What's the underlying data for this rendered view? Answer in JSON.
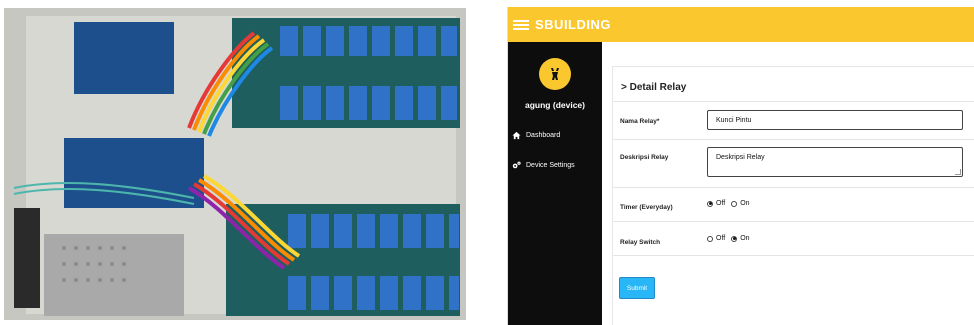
{
  "app": {
    "brand": "SBUILDING",
    "device_name": "agung (device)",
    "nav": [
      {
        "label": "Dashboard",
        "icon": "home-icon"
      },
      {
        "label": "Device Settings",
        "icon": "gears-icon"
      }
    ]
  },
  "detail": {
    "title": "> Detail Relay",
    "fields": {
      "nama_label": "Nama Relay*",
      "nama_value": "Kunci Pintu",
      "deskripsi_label": "Deskripsi Relay",
      "deskripsi_value": "Deskripsi Relay",
      "timer_label": "Timer (Everyday)",
      "timer_options": [
        "Off",
        "On"
      ],
      "timer_selected": "Off",
      "switch_label": "Relay Switch",
      "switch_options": [
        "Off",
        "On"
      ],
      "switch_selected": "On"
    },
    "submit_label": "Submit"
  },
  "colors": {
    "brand_yellow": "#fbc72f",
    "sidebar_bg": "#0d0d0d",
    "submit_blue": "#29b6f6"
  }
}
